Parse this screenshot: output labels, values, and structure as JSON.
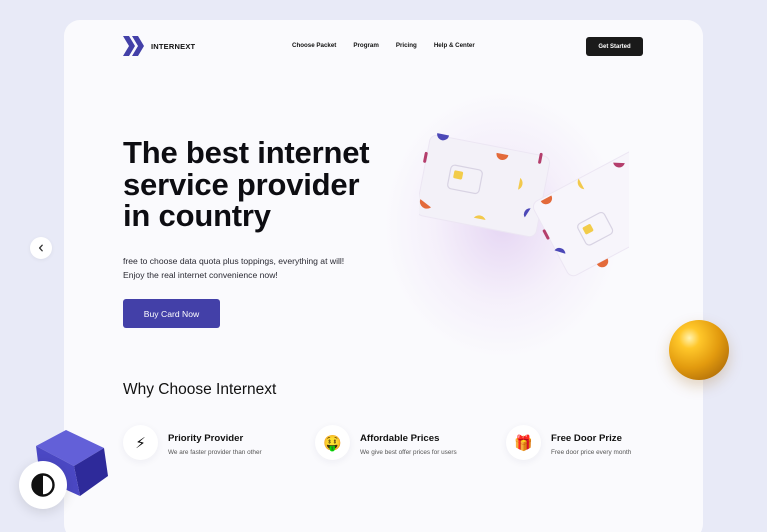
{
  "nav": {
    "brand": "INTERNEXT",
    "links": [
      "Choose Packet",
      "Program",
      "Pricing",
      "Help & Center"
    ],
    "cta": "Get Started"
  },
  "hero": {
    "title_line1": "The best internet",
    "title_line2": "service provider",
    "title_line3": "in country",
    "desc_line1": "free to choose data quota plus toppings, everything at will!",
    "desc_line2": "Enjoy the real internet convenience now!",
    "button": "Buy Card Now"
  },
  "why": {
    "title": "Why Choose Internext",
    "features": [
      {
        "icon": "lightning-icon",
        "glyph": "⚡",
        "title": "Priority Provider",
        "desc": "We are faster provider than other"
      },
      {
        "icon": "money-face-icon",
        "glyph": "🤑",
        "title": "Affordable Prices",
        "desc": "We give best offer prices for users"
      },
      {
        "icon": "gift-icon",
        "glyph": "🎁",
        "title": "Free Door Prize",
        "desc": "Free door price every month"
      }
    ]
  },
  "colors": {
    "page_bg": "#e8eaf7",
    "card_bg": "#fafafd",
    "accent": "#4340a8",
    "dark_button": "#1a1a1a",
    "ball": "#f5b21a",
    "cube": "#4b48c4"
  }
}
